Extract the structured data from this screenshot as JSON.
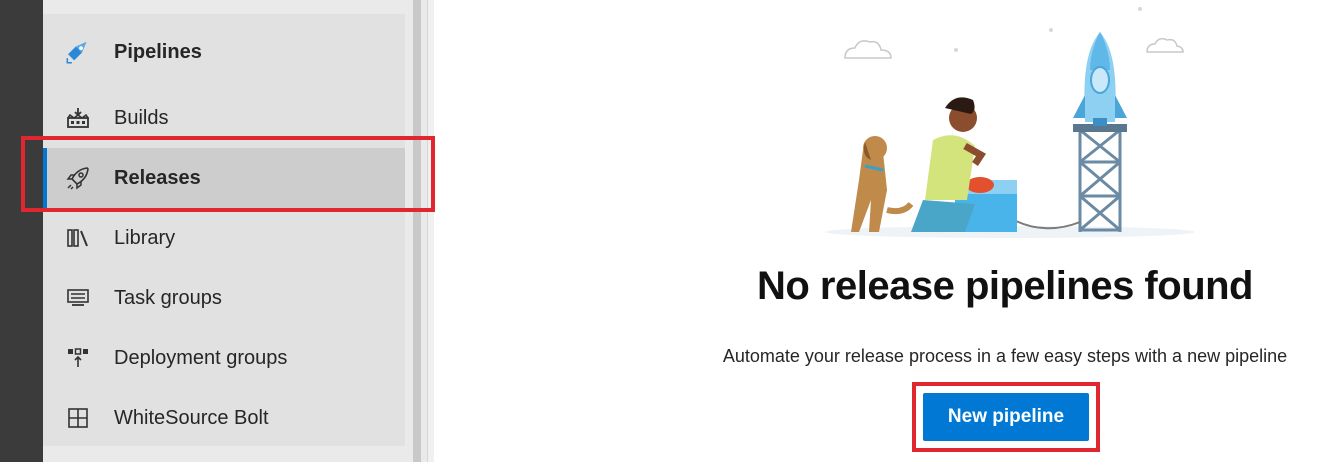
{
  "sidebar": {
    "header": {
      "label": "Pipelines",
      "icon": "pipelines-icon"
    },
    "items": [
      {
        "label": "Builds",
        "icon": "builds-icon",
        "selected": false
      },
      {
        "label": "Releases",
        "icon": "rocket-icon",
        "selected": true
      },
      {
        "label": "Library",
        "icon": "library-icon",
        "selected": false
      },
      {
        "label": "Task groups",
        "icon": "task-groups-icon",
        "selected": false
      },
      {
        "label": "Deployment groups",
        "icon": "deployment-groups-icon",
        "selected": false
      },
      {
        "label": "WhiteSource Bolt",
        "icon": "grid-icon",
        "selected": false
      }
    ]
  },
  "main": {
    "title": "No release pipelines found",
    "description": "Automate your release process in a few easy steps with a new pipeline",
    "button_label": "New pipeline"
  },
  "colors": {
    "accent": "#0078d4",
    "highlight": "#e0262f",
    "rail": "#3b3b3b"
  }
}
